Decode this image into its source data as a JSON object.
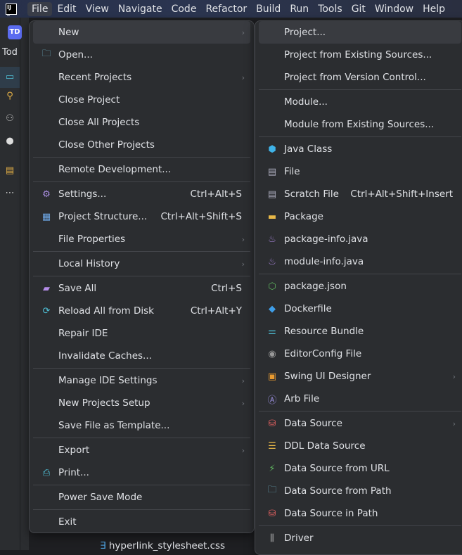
{
  "menubar": {
    "items": [
      "File",
      "Edit",
      "View",
      "Navigate",
      "Code",
      "Refactor",
      "Build",
      "Run",
      "Tools",
      "Git",
      "Window",
      "Help"
    ],
    "active": "File"
  },
  "project": {
    "badge": "TD",
    "name": "Tod"
  },
  "bottom_file": "hyperlink_stylesheet.css",
  "file_menu": [
    {
      "label": "New",
      "submenu": true,
      "selected": true
    },
    {
      "label": "Open...",
      "icon": "folder-icon"
    },
    {
      "label": "Recent Projects",
      "submenu": true
    },
    {
      "label": "Close Project"
    },
    {
      "label": "Close All Projects"
    },
    {
      "label": "Close Other Projects"
    },
    {
      "sep": true
    },
    {
      "label": "Remote Development..."
    },
    {
      "sep": true
    },
    {
      "label": "Settings...",
      "icon": "gear-icon",
      "shortcut": "Ctrl+Alt+S"
    },
    {
      "label": "Project Structure...",
      "icon": "project-structure-icon",
      "shortcut": "Ctrl+Alt+Shift+S"
    },
    {
      "label": "File Properties",
      "submenu": true
    },
    {
      "sep": true
    },
    {
      "label": "Local History",
      "submenu": true
    },
    {
      "sep": true
    },
    {
      "label": "Save All",
      "icon": "save-icon",
      "shortcut": "Ctrl+S"
    },
    {
      "label": "Reload All from Disk",
      "icon": "reload-icon",
      "shortcut": "Ctrl+Alt+Y"
    },
    {
      "label": "Repair IDE"
    },
    {
      "label": "Invalidate Caches..."
    },
    {
      "sep": true
    },
    {
      "label": "Manage IDE Settings",
      "submenu": true
    },
    {
      "label": "New Projects Setup",
      "submenu": true
    },
    {
      "label": "Save File as Template..."
    },
    {
      "sep": true
    },
    {
      "label": "Export",
      "submenu": true
    },
    {
      "label": "Print...",
      "icon": "print-icon"
    },
    {
      "sep": true
    },
    {
      "label": "Power Save Mode"
    },
    {
      "sep": true
    },
    {
      "label": "Exit"
    }
  ],
  "new_menu": [
    {
      "label": "Project...",
      "selected": true
    },
    {
      "label": "Project from Existing Sources..."
    },
    {
      "label": "Project from Version Control..."
    },
    {
      "sep": true
    },
    {
      "label": "Module..."
    },
    {
      "label": "Module from Existing Sources..."
    },
    {
      "sep": true
    },
    {
      "label": "Java Class",
      "icon": "java-class-icon"
    },
    {
      "label": "File",
      "icon": "file-icon"
    },
    {
      "label": "Scratch File",
      "icon": "scratch-file-icon",
      "shortcut": "Ctrl+Alt+Shift+Insert"
    },
    {
      "label": "Package",
      "icon": "package-icon"
    },
    {
      "label": "package-info.java",
      "icon": "java-icon"
    },
    {
      "label": "module-info.java",
      "icon": "java-icon"
    },
    {
      "sep": true
    },
    {
      "label": "package.json",
      "icon": "nodejs-icon"
    },
    {
      "label": "Dockerfile",
      "icon": "docker-icon"
    },
    {
      "label": "Resource Bundle",
      "icon": "resource-bundle-icon"
    },
    {
      "label": "EditorConfig File",
      "icon": "editorconfig-icon"
    },
    {
      "label": "Swing UI Designer",
      "icon": "swing-icon",
      "submenu": true
    },
    {
      "label": "Arb File",
      "icon": "arb-icon"
    },
    {
      "sep": true
    },
    {
      "label": "Data Source",
      "icon": "database-icon",
      "submenu": true
    },
    {
      "label": "DDL Data Source",
      "icon": "ddl-icon"
    },
    {
      "label": "Data Source from URL",
      "icon": "plug-icon"
    },
    {
      "label": "Data Source from Path",
      "icon": "folder-icon"
    },
    {
      "label": "Data Source in Path",
      "icon": "database-icon"
    },
    {
      "sep": true
    },
    {
      "label": "Driver",
      "icon": "driver-icon"
    }
  ],
  "colors": {
    "accent": "#5b6cf0",
    "menu_bg": "#2b2d30",
    "selection": "#393b40"
  }
}
